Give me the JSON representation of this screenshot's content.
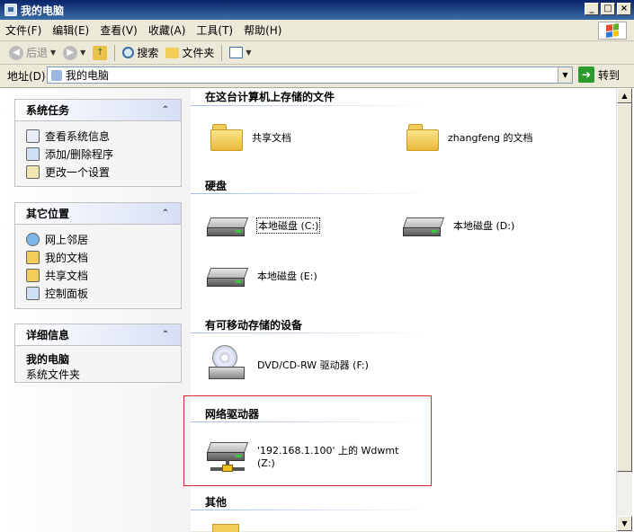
{
  "window": {
    "title": "我的电脑",
    "min": "_",
    "max": "□",
    "close": "×"
  },
  "menu": [
    "文件(F)",
    "编辑(E)",
    "查看(V)",
    "收藏(A)",
    "工具(T)",
    "帮助(H)"
  ],
  "toolbar": {
    "back": "后退",
    "search": "搜索",
    "folders": "文件夹"
  },
  "address": {
    "label": "地址(D)",
    "value": "我的电脑",
    "go": "转到"
  },
  "tasks": {
    "system": {
      "title": "系统任务",
      "items": [
        "查看系统信息",
        "添加/删除程序",
        "更改一个设置"
      ]
    },
    "places": {
      "title": "其它位置",
      "items": [
        "网上邻居",
        "我的文档",
        "共享文档",
        "控制面板"
      ]
    },
    "details": {
      "title": "详细信息",
      "name": "我的电脑",
      "desc": "系统文件夹"
    }
  },
  "groups": {
    "stored": {
      "title": "在这台计算机上存储的文件",
      "items": [
        "共享文档",
        "zhangfeng 的文档"
      ]
    },
    "hdd": {
      "title": "硬盘",
      "items": [
        "本地磁盘 (C:)",
        "本地磁盘 (D:)",
        "本地磁盘 (E:)"
      ]
    },
    "removable": {
      "title": "有可移动存储的设备",
      "items": [
        "DVD/CD-RW 驱动器 (F:)"
      ]
    },
    "network": {
      "title": "网络驱动器",
      "line1": "'192.168.1.100' 上的 Wdwmt",
      "line2": "(Z:)"
    },
    "other": {
      "title": "其他"
    }
  },
  "colors": {
    "title_bar": "#0a246a",
    "highlight_box": "#d42a2a",
    "go_button": "#2c9a2c"
  },
  "icons": {
    "window": "my-computer-icon",
    "go": "arrow-right-icon",
    "folder": "folder-icon",
    "disk": "hard-disk-icon",
    "cd": "cd-drive-icon",
    "net": "network-drive-icon"
  }
}
